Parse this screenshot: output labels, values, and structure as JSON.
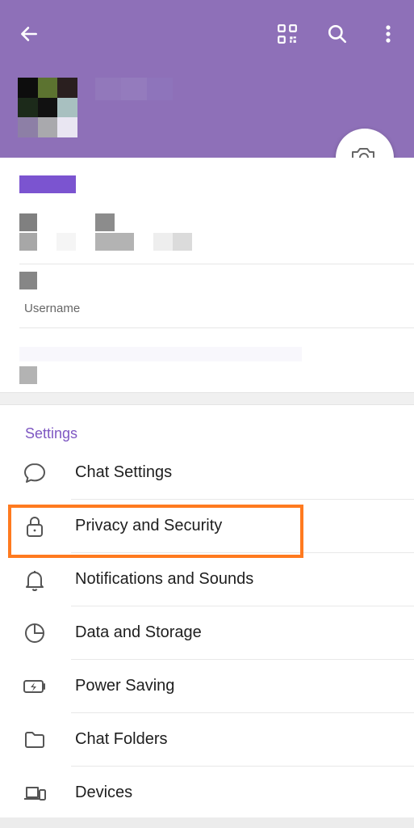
{
  "header": {
    "back_icon": "arrow-left-icon",
    "qr_icon": "qr-code-icon",
    "search_icon": "search-icon",
    "more_icon": "more-vertical-icon",
    "background": "#8e70b8"
  },
  "camera_icon": "camera-add-icon",
  "account": {
    "username_caption": "Username"
  },
  "settings": {
    "section_title": "Settings",
    "items": [
      {
        "label": "Chat Settings",
        "icon": "chat-bubble-icon"
      },
      {
        "label": "Privacy and Security",
        "icon": "lock-icon"
      },
      {
        "label": "Notifications and Sounds",
        "icon": "bell-icon"
      },
      {
        "label": "Data and Storage",
        "icon": "pie-chart-icon"
      },
      {
        "label": "Power Saving",
        "icon": "battery-icon"
      },
      {
        "label": "Chat Folders",
        "icon": "folder-icon"
      },
      {
        "label": "Devices",
        "icon": "devices-icon"
      }
    ]
  },
  "colors": {
    "accent": "#7e57c2",
    "highlight": "#ff7a1f"
  }
}
